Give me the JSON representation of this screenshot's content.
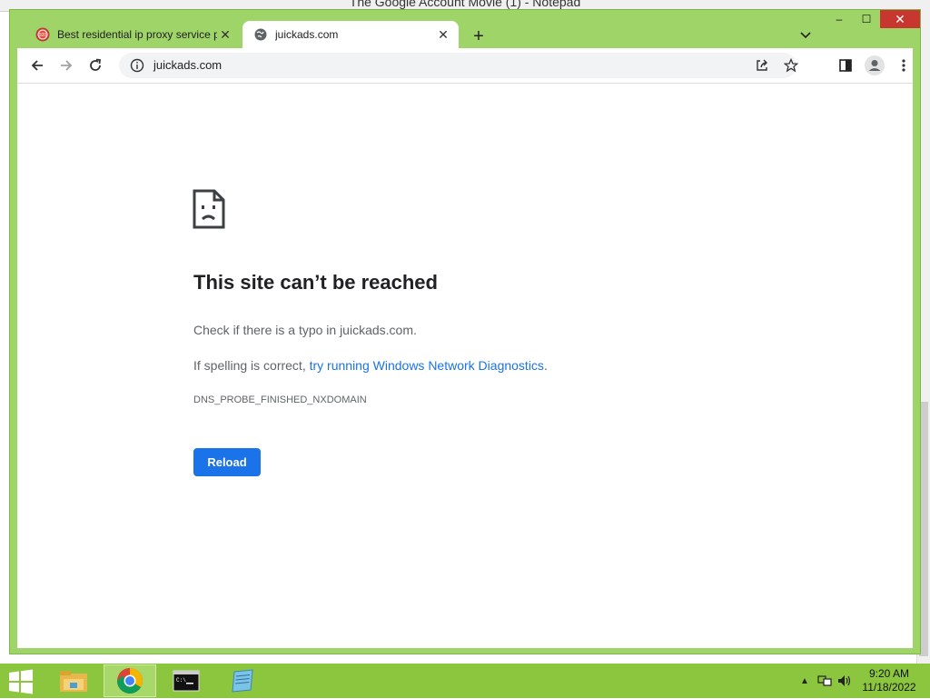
{
  "background_window": {
    "title": "The Google Account Movie (1) - Notepad"
  },
  "browser": {
    "tabs": [
      {
        "title": "Best residential ip proxy service p",
        "favicon": "proxy-site-icon",
        "active": false
      },
      {
        "title": "juickads.com",
        "favicon": "globe-icon",
        "active": true
      }
    ],
    "new_tab_symbol": "+",
    "address_bar": {
      "url": "juickads.com"
    },
    "window_controls": {
      "minimize": "–",
      "maximize": "☐",
      "close": "✕"
    }
  },
  "error_page": {
    "title": "This site can’t be reached",
    "line1": "Check if there is a typo in juickads.com.",
    "line2_prefix": "If spelling is correct, ",
    "line2_link": "try running Windows Network Diagnostics",
    "line2_suffix": ".",
    "error_code": "DNS_PROBE_FINISHED_NXDOMAIN",
    "reload_label": "Reload"
  },
  "taskbar": {
    "apps": [
      "file-explorer-icon",
      "chrome-icon",
      "command-prompt-icon",
      "notepad-icon"
    ],
    "active_app": "chrome-icon",
    "clock_time": "9:20 AM",
    "clock_date": "11/18/2022"
  },
  "colors": {
    "window_frame": "#9fd469",
    "taskbar": "#8cc63f",
    "accent_blue": "#1a73e8",
    "close_red": "#c7372f"
  }
}
